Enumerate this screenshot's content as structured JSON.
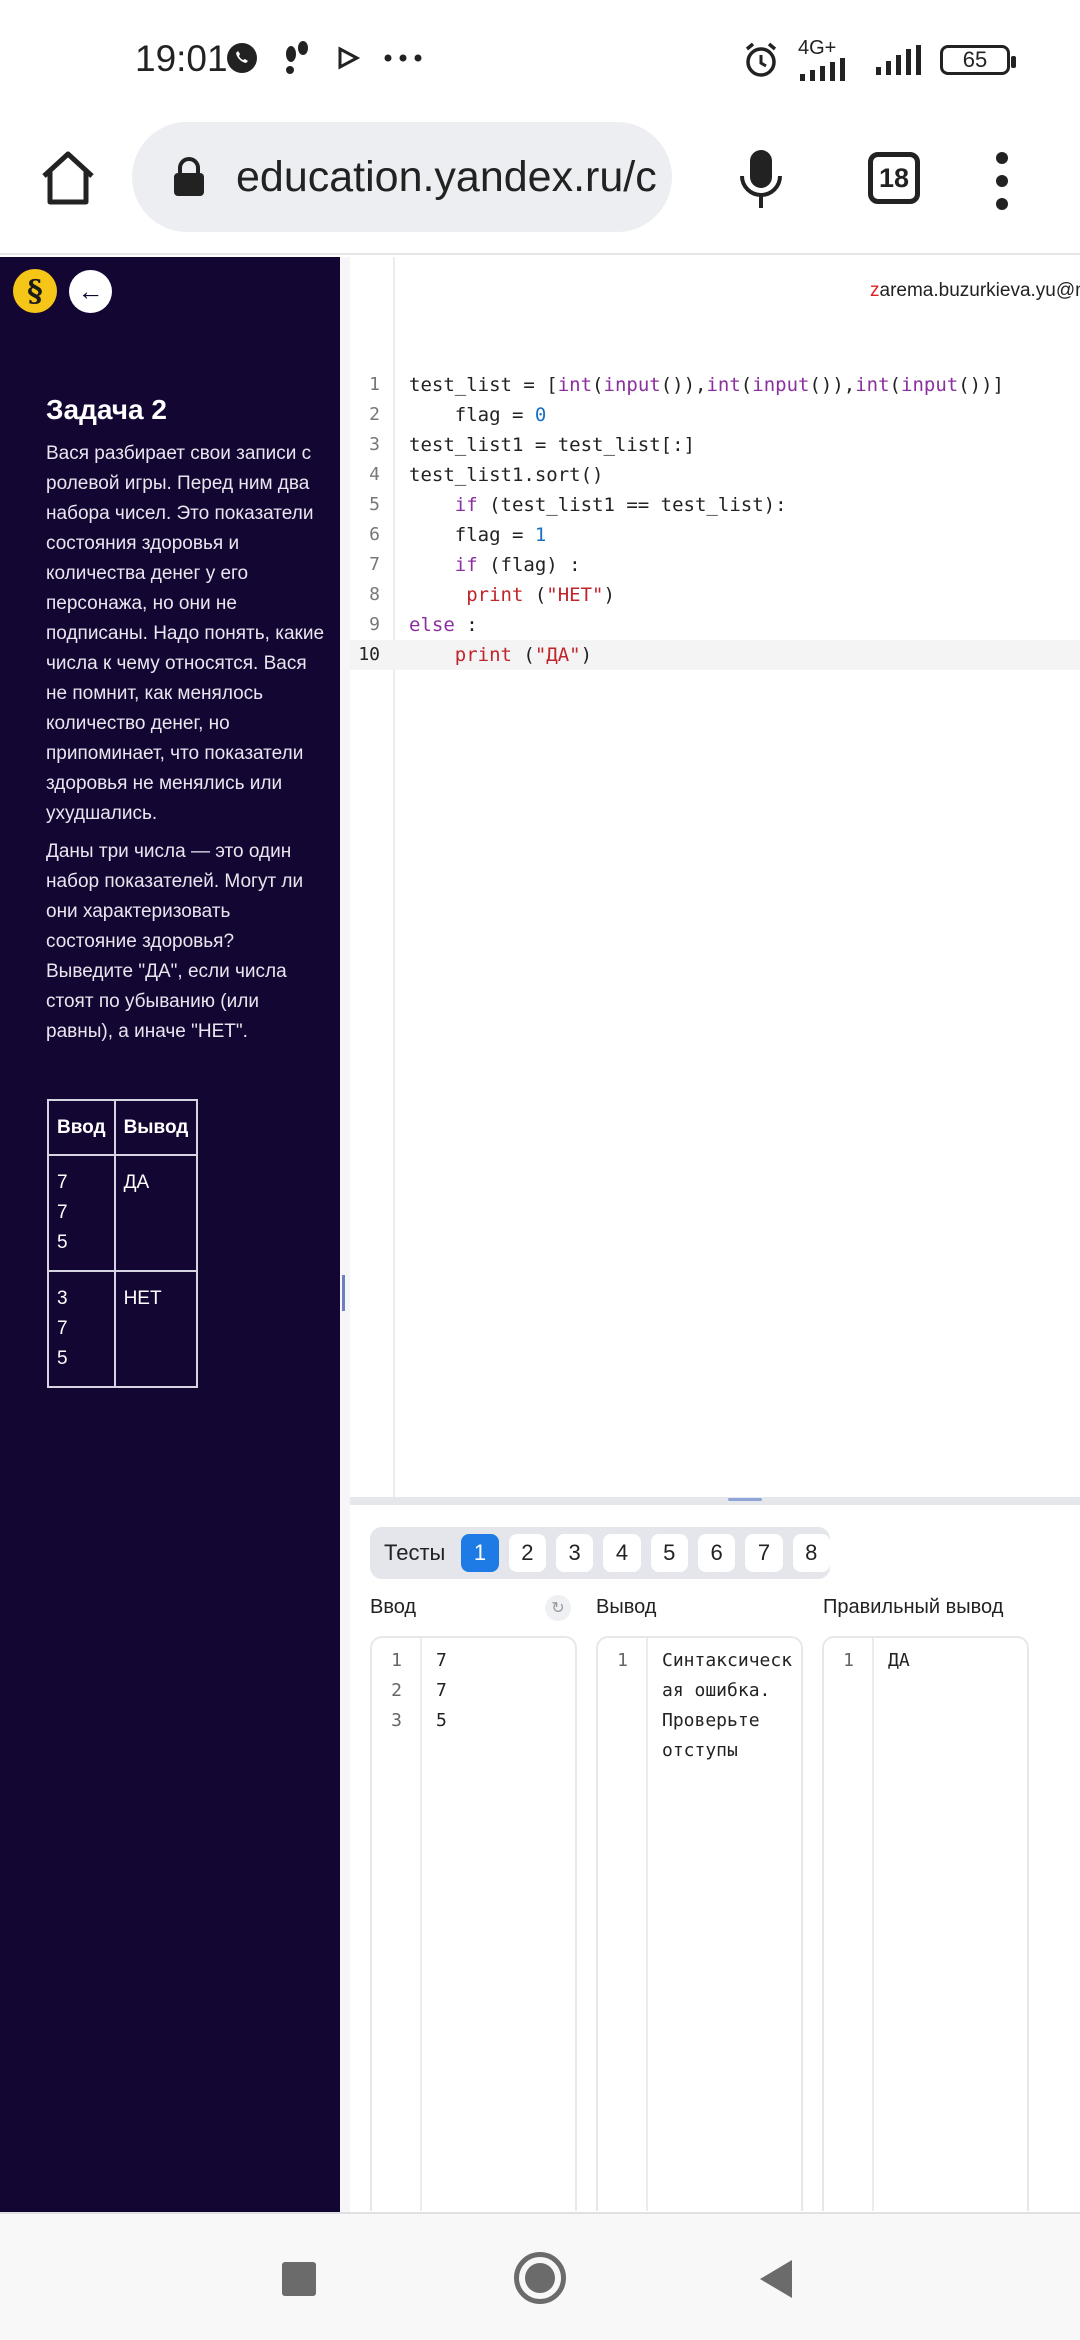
{
  "status_bar": {
    "time": "19:01",
    "network": "4G+",
    "battery": "65",
    "icons": [
      "whatsapp-icon",
      "footsteps-icon",
      "play-icon",
      "more-dots-icon",
      "alarm-icon",
      "signal-icon",
      "signal-icon-2",
      "battery-icon"
    ]
  },
  "browser": {
    "url": "education.yandex.ru/c",
    "tabs_count": "18"
  },
  "sidebar": {
    "logo": "§",
    "back_arrow": "←",
    "task_title": "Задача 2",
    "paragraph_1": "Вася разбирает свои записи с ролевой игры. Перед ним два набора чисел. Это показатели состояния здоровья и количества денег у его персонажа, но они не подписаны. Надо понять, какие числа к чему относятся. Вася не помнит, как менялось количество денег, но припоминает, что показатели здоровья не менялись или ухудшались.",
    "paragraph_2": "Даны три числа — это один набор показателей. Могут ли они характеризовать состояние здоровья? Выведите \"ДА\", если числа стоят по убыванию (или равны), а иначе \"НЕТ\".",
    "example_table": {
      "headers": [
        "Ввод",
        "Вывод"
      ],
      "rows": [
        {
          "input": [
            "7",
            "7",
            "5"
          ],
          "output": "ДА"
        },
        {
          "input": [
            "3",
            "7",
            "5"
          ],
          "output": "НЕТ"
        }
      ]
    }
  },
  "user": {
    "email_first": "z",
    "email_rest": "arema.buzurkieva.yu@m"
  },
  "editor": {
    "lines": [
      {
        "n": "1",
        "text": "test_list = [int(input()),int(input()),int(input())]"
      },
      {
        "n": "2",
        "text": "    flag = 0"
      },
      {
        "n": "3",
        "text": "test_list1 = test_list[:]"
      },
      {
        "n": "4",
        "text": "test_list1.sort()"
      },
      {
        "n": "5",
        "text": "    if (test_list1 == test_list):"
      },
      {
        "n": "6",
        "text": "    flag = 1"
      },
      {
        "n": "7",
        "text": "    if (flag) :"
      },
      {
        "n": "8",
        "text": "     print (\"НЕТ\")"
      },
      {
        "n": "9",
        "text": "else :"
      },
      {
        "n": "10",
        "text": "    print (\"ДА\")"
      }
    ]
  },
  "tests": {
    "label": "Тесты",
    "numbers": [
      "1",
      "2",
      "3",
      "4",
      "5",
      "6",
      "7",
      "8"
    ],
    "selected": "1",
    "input_title": "Ввод",
    "output_title": "Вывод",
    "expected_title": "Правильный вывод",
    "reset_icon": "↻",
    "input_lines": [
      {
        "n": "1",
        "text": "7"
      },
      {
        "n": "2",
        "text": "7"
      },
      {
        "n": "3",
        "text": "5"
      }
    ],
    "output_lines": [
      {
        "n": "1",
        "text": "Синтаксическ"
      },
      {
        "n": "",
        "text": "ая ошибка."
      },
      {
        "n": "",
        "text": "Проверьте"
      },
      {
        "n": "",
        "text": "отступы"
      }
    ],
    "expected_lines": [
      {
        "n": "1",
        "text": "ДА"
      }
    ]
  }
}
